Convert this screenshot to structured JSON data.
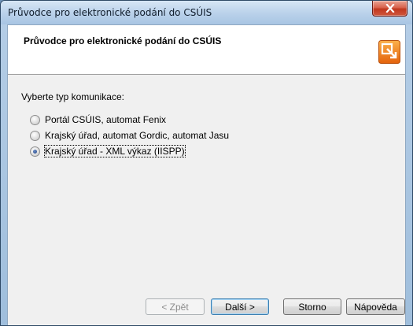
{
  "window": {
    "title": "Průvodce pro elektronické podání do CSÚIS"
  },
  "header": {
    "title": "Průvodce pro elektronické podání do CSÚIS",
    "icon": "wizard-export-icon"
  },
  "prompt": "Vyberte typ komunikace:",
  "options": [
    {
      "label": "Portál CSÚIS, automat Fenix",
      "checked": false
    },
    {
      "label": "Krajský úřad, automat Gordic, automat Jasu",
      "checked": false
    },
    {
      "label": "Krajský úřad - XML výkaz (IISPP)",
      "checked": true
    }
  ],
  "buttons": {
    "back": "< Zpět",
    "next": "Další >",
    "cancel": "Storno",
    "help": "Nápověda"
  },
  "colors": {
    "close_button": "#c7432c",
    "icon_orange": "#f07a1a"
  }
}
